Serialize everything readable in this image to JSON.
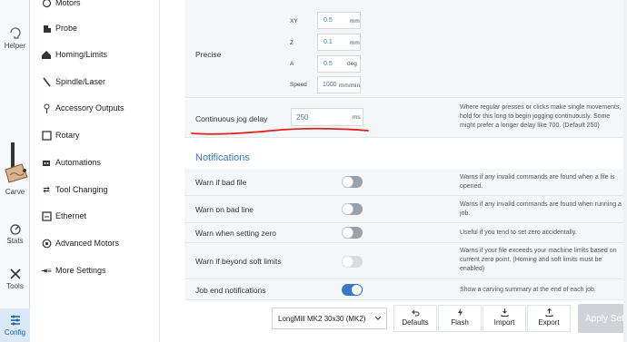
{
  "rail": [
    {
      "label": "Helper",
      "icon": "helper-icon"
    },
    {
      "label": "Carve",
      "icon": "carve-icon"
    },
    {
      "label": "Stats",
      "icon": "stats-icon"
    },
    {
      "label": "Tools",
      "icon": "tools-icon"
    },
    {
      "label": "Config",
      "icon": "config-icon"
    }
  ],
  "menu": [
    {
      "label": "Motors",
      "icon": "motors-icon"
    },
    {
      "label": "Probe",
      "icon": "probe-icon"
    },
    {
      "label": "Homing/Limits",
      "icon": "home-icon"
    },
    {
      "label": "Spindle/Laser",
      "icon": "spindle-icon"
    },
    {
      "label": "Accessory Outputs",
      "icon": "accessory-icon"
    },
    {
      "label": "Rotary",
      "icon": "rotary-icon"
    },
    {
      "label": "Automations",
      "icon": "automations-icon"
    },
    {
      "label": "Tool Changing",
      "icon": "tool-change-icon"
    },
    {
      "label": "Ethernet",
      "icon": "ethernet-icon"
    },
    {
      "label": "Advanced Motors",
      "icon": "advanced-motors-icon"
    },
    {
      "label": "More Settings",
      "icon": "more-settings-icon"
    }
  ],
  "precise": {
    "label": "Precise",
    "fields": [
      {
        "axis": "XY",
        "value": "0.5",
        "unit": "mm"
      },
      {
        "axis": "Z",
        "value": "0.1",
        "unit": "mm"
      },
      {
        "axis": "A",
        "value": "0.5",
        "unit": "deg"
      },
      {
        "axis": "Speed",
        "value": "1000",
        "unit": "mm/min"
      }
    ]
  },
  "jog_delay": {
    "label": "Continuous jog delay",
    "value": "250",
    "unit": "ms",
    "description": "Where regular presses or clicks make single movements, hold for this long to begin jogging continuously. Some might prefer a longer delay like 700. (Default 250)"
  },
  "notifications": {
    "title": "Notifications",
    "rows": [
      {
        "label": "Warn if bad file",
        "state": "off",
        "description": "Warns if any invalid commands are found when a file is opened."
      },
      {
        "label": "Warn on bad line",
        "state": "off",
        "description": "Warns if any invalid commands are found when running a job."
      },
      {
        "label": "Warn when setting zero",
        "state": "off",
        "description": "Useful if you tend to set zero accidentally."
      },
      {
        "label": "Warn if beyond soft limits",
        "state": "disabled",
        "description": "Warns if your file exceeds your machine limits based on current zero point. (Homing and soft limits must be enabled)"
      },
      {
        "label": "Job end notifications",
        "state": "on",
        "description": "Show a carving summary at the end of each job."
      }
    ]
  },
  "footer": {
    "machine": "LongMill MK2 30x30 (MK2)",
    "defaults": "Defaults",
    "flash": "Flash",
    "import": "Import",
    "export": "Export",
    "apply": "Apply Setti"
  },
  "colors": {
    "accent": "#3a76c4",
    "annotation": "#e02020"
  }
}
